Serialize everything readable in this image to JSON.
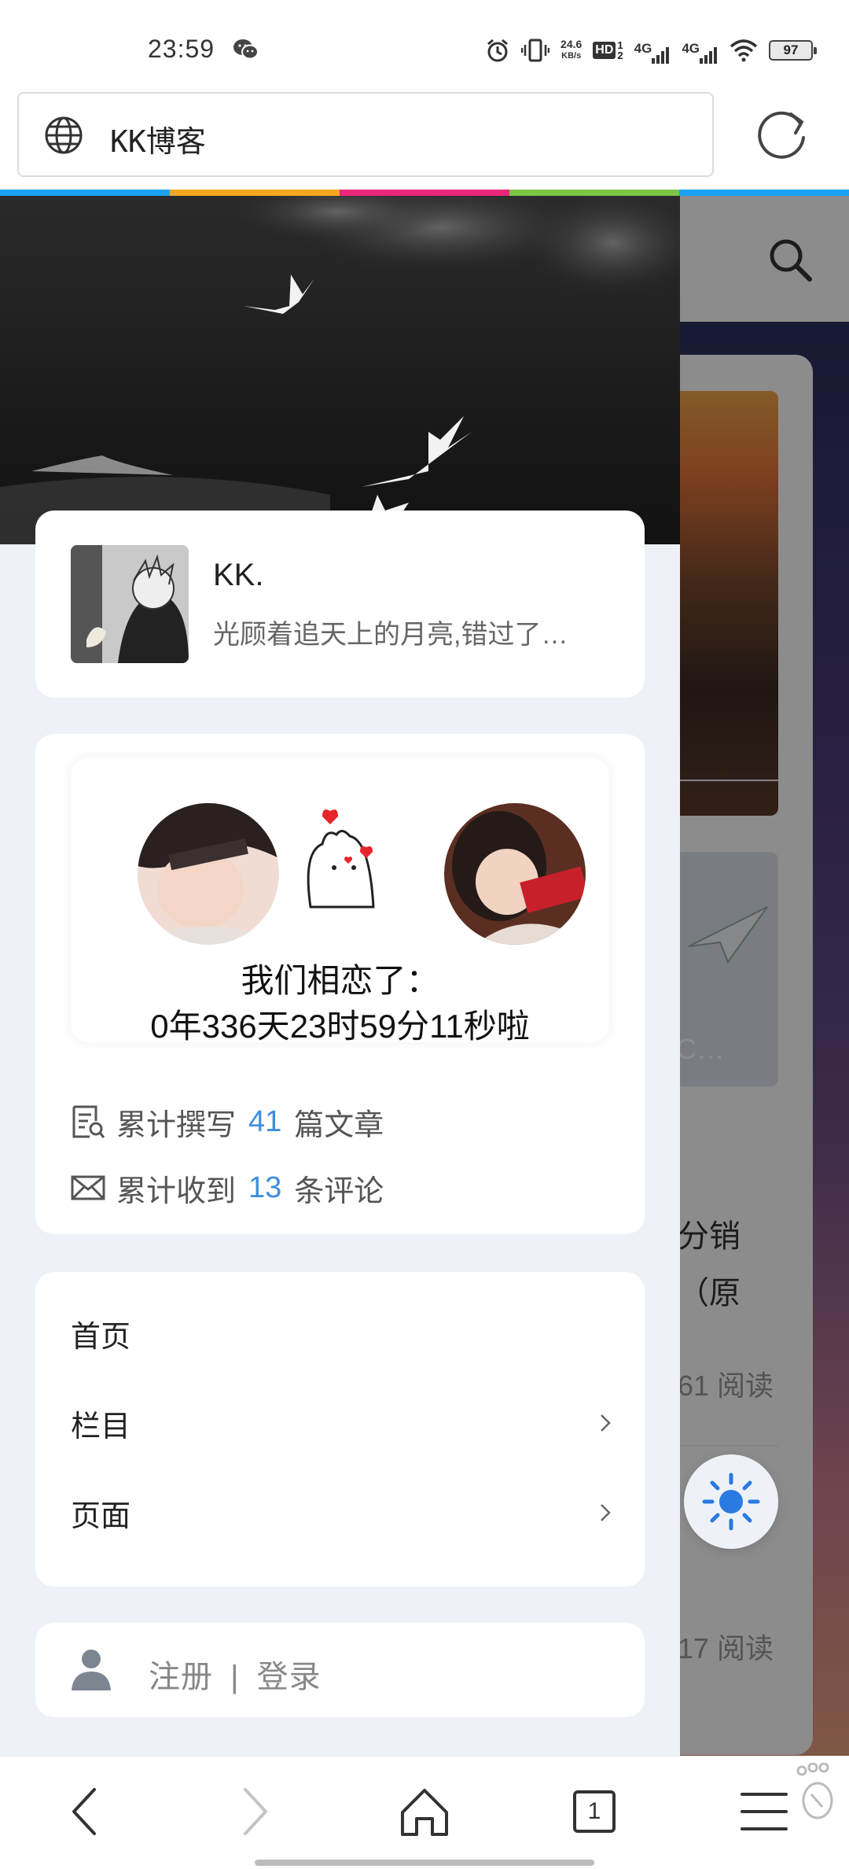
{
  "status_bar": {
    "time": "23:59",
    "net_speed_value": "24.6",
    "net_speed_unit": "KB/s",
    "hd_label": "HD",
    "signal_1": "4G",
    "signal_2": "4G",
    "battery": "97"
  },
  "address_bar": {
    "title": "KK博客"
  },
  "progress_colors": [
    "#f5a623",
    "#e8267a",
    "#7cc544",
    "#1da1f2"
  ],
  "profile": {
    "name": "KK.",
    "bio": "光顾着追天上的月亮,错过了…"
  },
  "love": {
    "title": "我们相恋了：",
    "counter": "0年336天23时59分11秒啦"
  },
  "stats": {
    "articles_prefix": "累计撰写",
    "articles_count": "41",
    "articles_suffix": "篇文章",
    "comments_prefix": "累计收到",
    "comments_count": "13",
    "comments_suffix": "条评论"
  },
  "menu": {
    "items": [
      {
        "label": "首页",
        "has_arrow": false
      },
      {
        "label": "栏目",
        "has_arrow": true
      },
      {
        "label": "页面",
        "has_arrow": true
      }
    ]
  },
  "auth": {
    "register": "注册",
    "separator": "|",
    "login": "登录"
  },
  "background_page": {
    "line1": "分销",
    "line2": "（原",
    "meta1": "61 阅读",
    "meta2": "17 阅读",
    "img_caption": "C…"
  },
  "bottom_nav": {
    "tab_count": "1"
  },
  "colors": {
    "accent_blue": "#3d8fe0",
    "drawer_bg": "#eef1f8"
  }
}
